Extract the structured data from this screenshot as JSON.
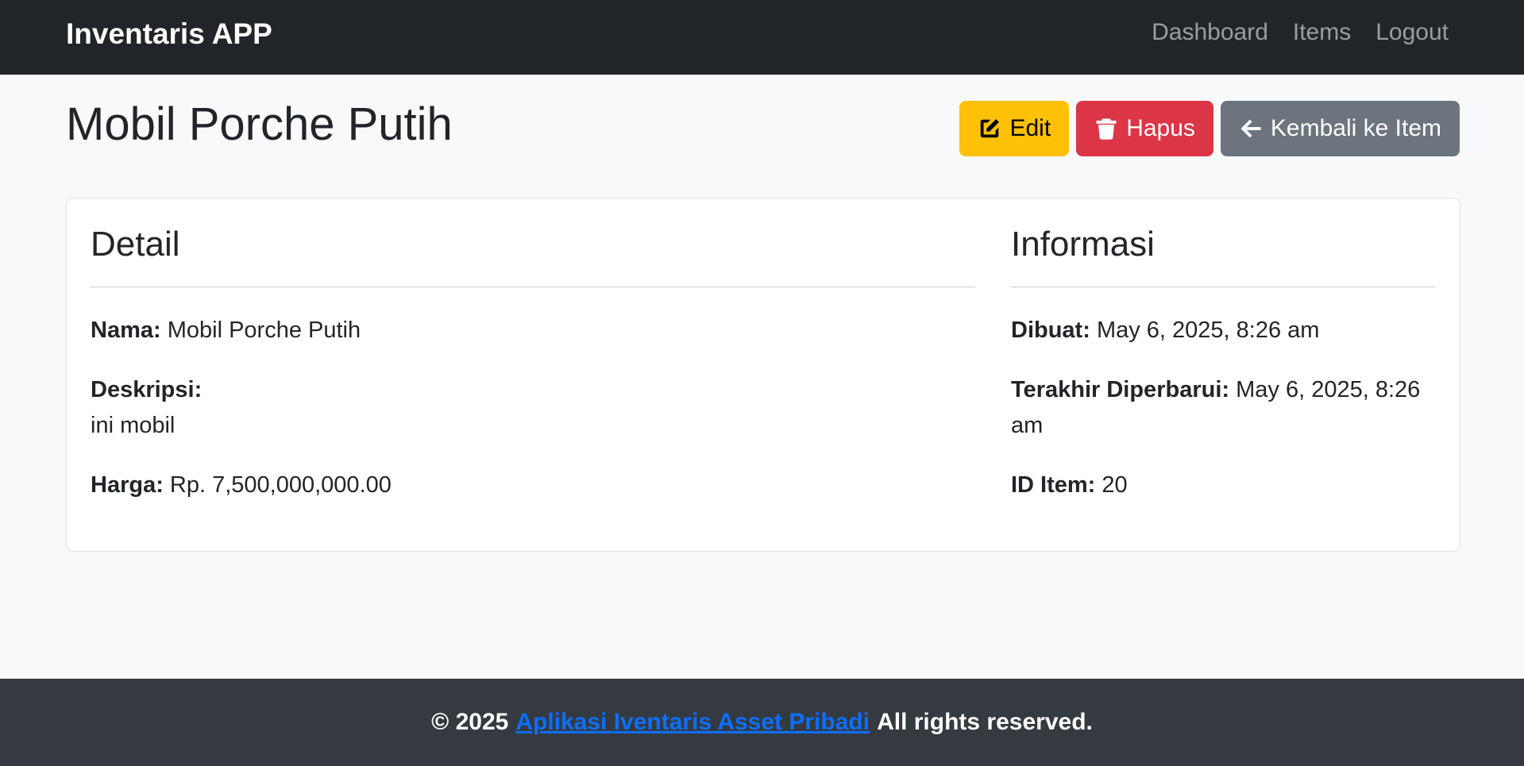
{
  "navbar": {
    "brand": "Inventaris APP",
    "links": [
      "Dashboard",
      "Items",
      "Logout"
    ]
  },
  "page": {
    "title": "Mobil Porche Putih",
    "actions": {
      "edit": "Edit",
      "delete": "Hapus",
      "back": "Kembali ke Item"
    }
  },
  "detail": {
    "heading": "Detail",
    "name_label": "Nama:",
    "name_value": "Mobil Porche Putih",
    "desc_label": "Deskripsi:",
    "desc_value": "ini mobil",
    "price_label": "Harga:",
    "price_value": "Rp. 7,500,000,000.00"
  },
  "info": {
    "heading": "Informasi",
    "created_label": "Dibuat:",
    "created_value": "May 6, 2025, 8:26 am",
    "updated_label": "Terakhir Diperbarui:",
    "updated_value": "May 6, 2025, 8:26 am",
    "id_label": "ID Item:",
    "id_value": "20"
  },
  "footer": {
    "prefix": "© 2025",
    "link": "Aplikasi Iventaris Asset Pribadi",
    "suffix": "All rights reserved."
  },
  "colors": {
    "navbar_bg": "#212529",
    "warning": "#ffc107",
    "danger": "#dc3545",
    "secondary": "#6c757d",
    "footer_bg": "#343a40",
    "link": "#0d6efd"
  },
  "icons": {
    "edit": "edit-icon",
    "delete": "trash-icon",
    "back": "arrow-left-icon"
  }
}
